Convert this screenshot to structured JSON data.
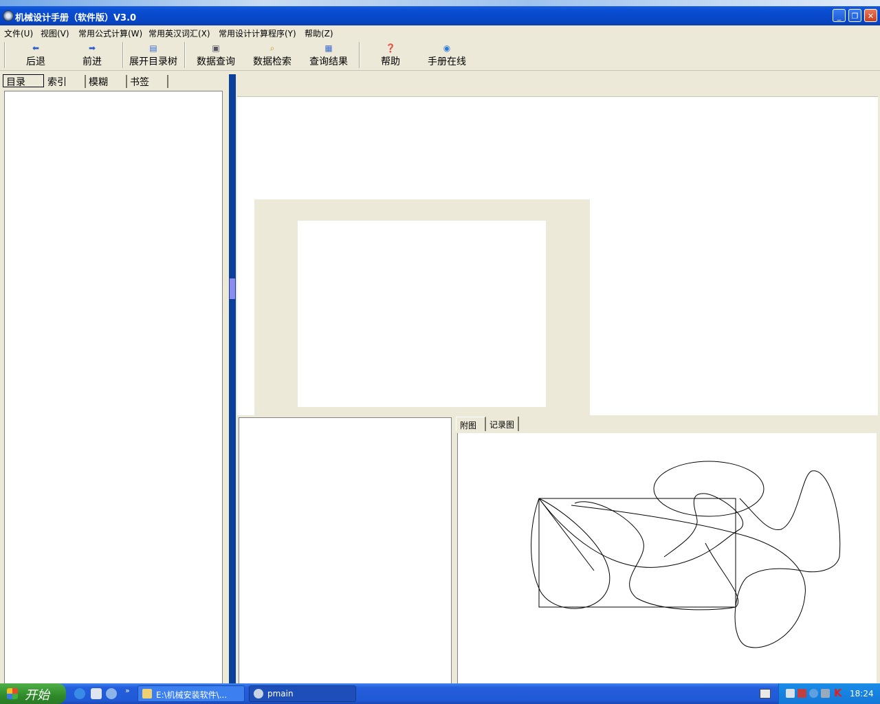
{
  "window": {
    "title": "机械设计手册（软件版）V3.0"
  },
  "menu": [
    "文件(U)",
    "视图(V)",
    "常用公式计算(W)",
    "常用英汉词汇(X)",
    "常用设计计算程序(Y)",
    "帮助(Z)"
  ],
  "toolbar": {
    "back": "后退",
    "forward": "前进",
    "expand_tree": "展开目录树",
    "data_query": "数据查询",
    "data_search": "数据检索",
    "query_results": "查询结果",
    "help": "帮助",
    "online": "手册在线"
  },
  "left_tabs": [
    "目录",
    "索引",
    "模糊",
    "书签"
  ],
  "figure_tabs": [
    "附图",
    "记录图"
  ],
  "taskbar": {
    "start": "开始",
    "tasks": [
      "E:\\机械安装软件\\...",
      "pmain"
    ],
    "clock": "18:24"
  },
  "colors": {
    "title_bar": "#0a4fd4",
    "splitter": "#0a3f9c",
    "taskbar": "#245edc",
    "start": "#2f8a2a"
  },
  "icons": [
    "app-icon",
    "back-arrow-icon",
    "forward-arrow-icon",
    "tree-icon",
    "query-icon",
    "search-icon",
    "results-icon",
    "help-icon",
    "globe-icon"
  ]
}
